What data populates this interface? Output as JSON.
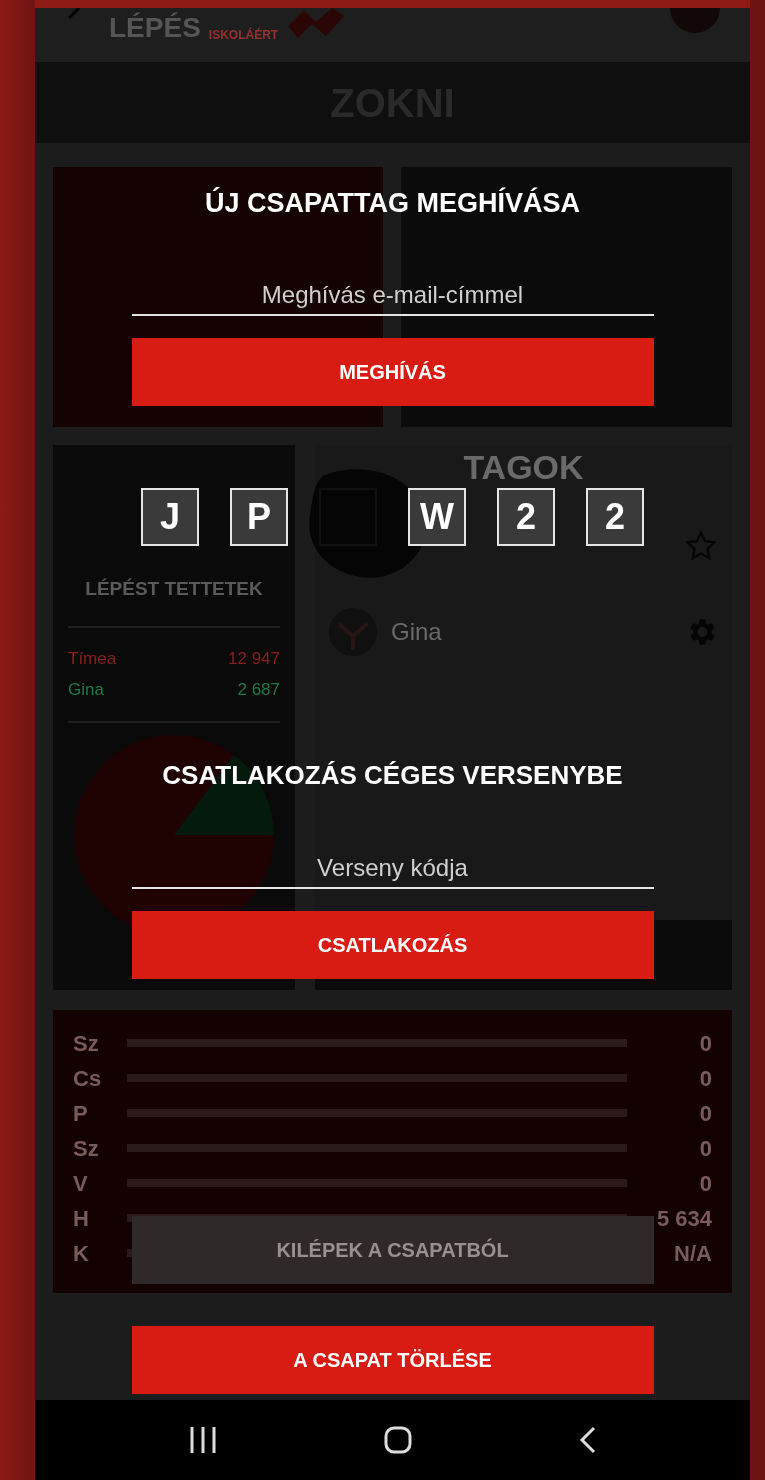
{
  "header": {
    "logo_text": "LÉPÉS",
    "logo_subtext": "ISKOLÁÉRT"
  },
  "team_name": "ZOKNI",
  "stage_card": {
    "caption": "LÉPÉST TETTETEK",
    "members": [
      {
        "name": "Tímea",
        "steps": "12 947",
        "color": "#8a1f1f"
      },
      {
        "name": "Gina",
        "steps": "2 687",
        "color": "#1f7a48"
      }
    ]
  },
  "members_panel": {
    "title": "TAGOK",
    "members": [
      {
        "kind": "owner"
      },
      {
        "name": "Gina",
        "kind": "member"
      }
    ]
  },
  "stats": [
    {
      "label": "Sz",
      "value": "0"
    },
    {
      "label": "Cs",
      "value": "0"
    },
    {
      "label": "P",
      "value": "0"
    },
    {
      "label": "Sz",
      "value": "0"
    },
    {
      "label": "V",
      "value": "0"
    },
    {
      "label": "H",
      "value": "5 634"
    },
    {
      "label": "K",
      "value": "N/A"
    }
  ],
  "invite": {
    "title": "ÚJ CSAPATTAG MEGHÍVÁSA",
    "placeholder": "Meghívás e-mail-címmel",
    "button": "MEGHÍVÁS"
  },
  "team_code": [
    {
      "char": "J",
      "obscured": false
    },
    {
      "char": "P",
      "obscured": false
    },
    {
      "obscured": true
    },
    {
      "char": "W",
      "obscured": false
    },
    {
      "char": "2",
      "obscured": false
    },
    {
      "char": "2",
      "obscured": false
    }
  ],
  "competition": {
    "title": "CSATLAKOZÁS CÉGES VERSENYBE",
    "placeholder": "Verseny kódja",
    "button": "CSATLAKOZÁS"
  },
  "actions": [
    {
      "label": "KILÉPEK A CSAPATBÓL",
      "kind": "muted"
    },
    {
      "label": "A CSAPAT TÖRLÉSE",
      "kind": "danger"
    }
  ]
}
